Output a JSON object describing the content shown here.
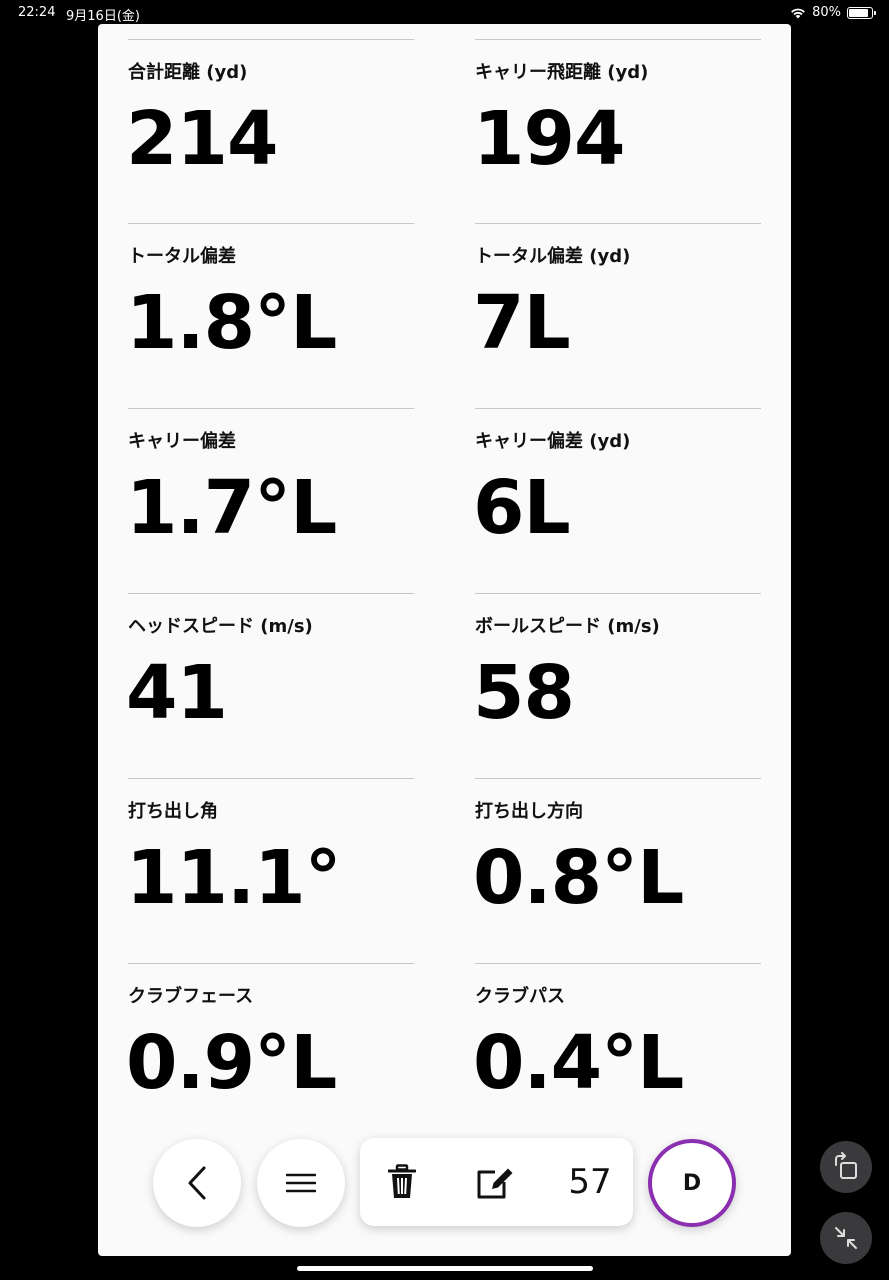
{
  "status": {
    "time": "22:24",
    "date": "9月16日(金)",
    "battery": "80%"
  },
  "metrics": [
    {
      "label": "合計距離 (yd)",
      "value": "214"
    },
    {
      "label": "キャリー飛距離 (yd)",
      "value": "194"
    },
    {
      "label": "トータル偏差",
      "value": "1.8°L"
    },
    {
      "label": "トータル偏差 (yd)",
      "value": "7L"
    },
    {
      "label": "キャリー偏差",
      "value": "1.7°L"
    },
    {
      "label": "キャリー偏差 (yd)",
      "value": "6L"
    },
    {
      "label": "ヘッドスピード (m/s)",
      "value": "41"
    },
    {
      "label": "ボールスピード (m/s)",
      "value": "58"
    },
    {
      "label": "打ち出し角",
      "value": "11.1°"
    },
    {
      "label": "打ち出し方向",
      "value": "0.8°L"
    },
    {
      "label": "クラブフェース",
      "value": "0.9°L"
    },
    {
      "label": "クラブパス",
      "value": "0.4°L"
    }
  ],
  "toolbar": {
    "shot_count": "57",
    "club": "D"
  },
  "icons": {
    "back": "chevron-left-icon",
    "menu": "hamburger-menu-icon",
    "delete": "trash-icon",
    "edit": "edit-icon",
    "rotate": "rotate-screen-icon",
    "minimize": "minimize-icon"
  },
  "colors": {
    "club_ring": "#8a2fb0"
  }
}
